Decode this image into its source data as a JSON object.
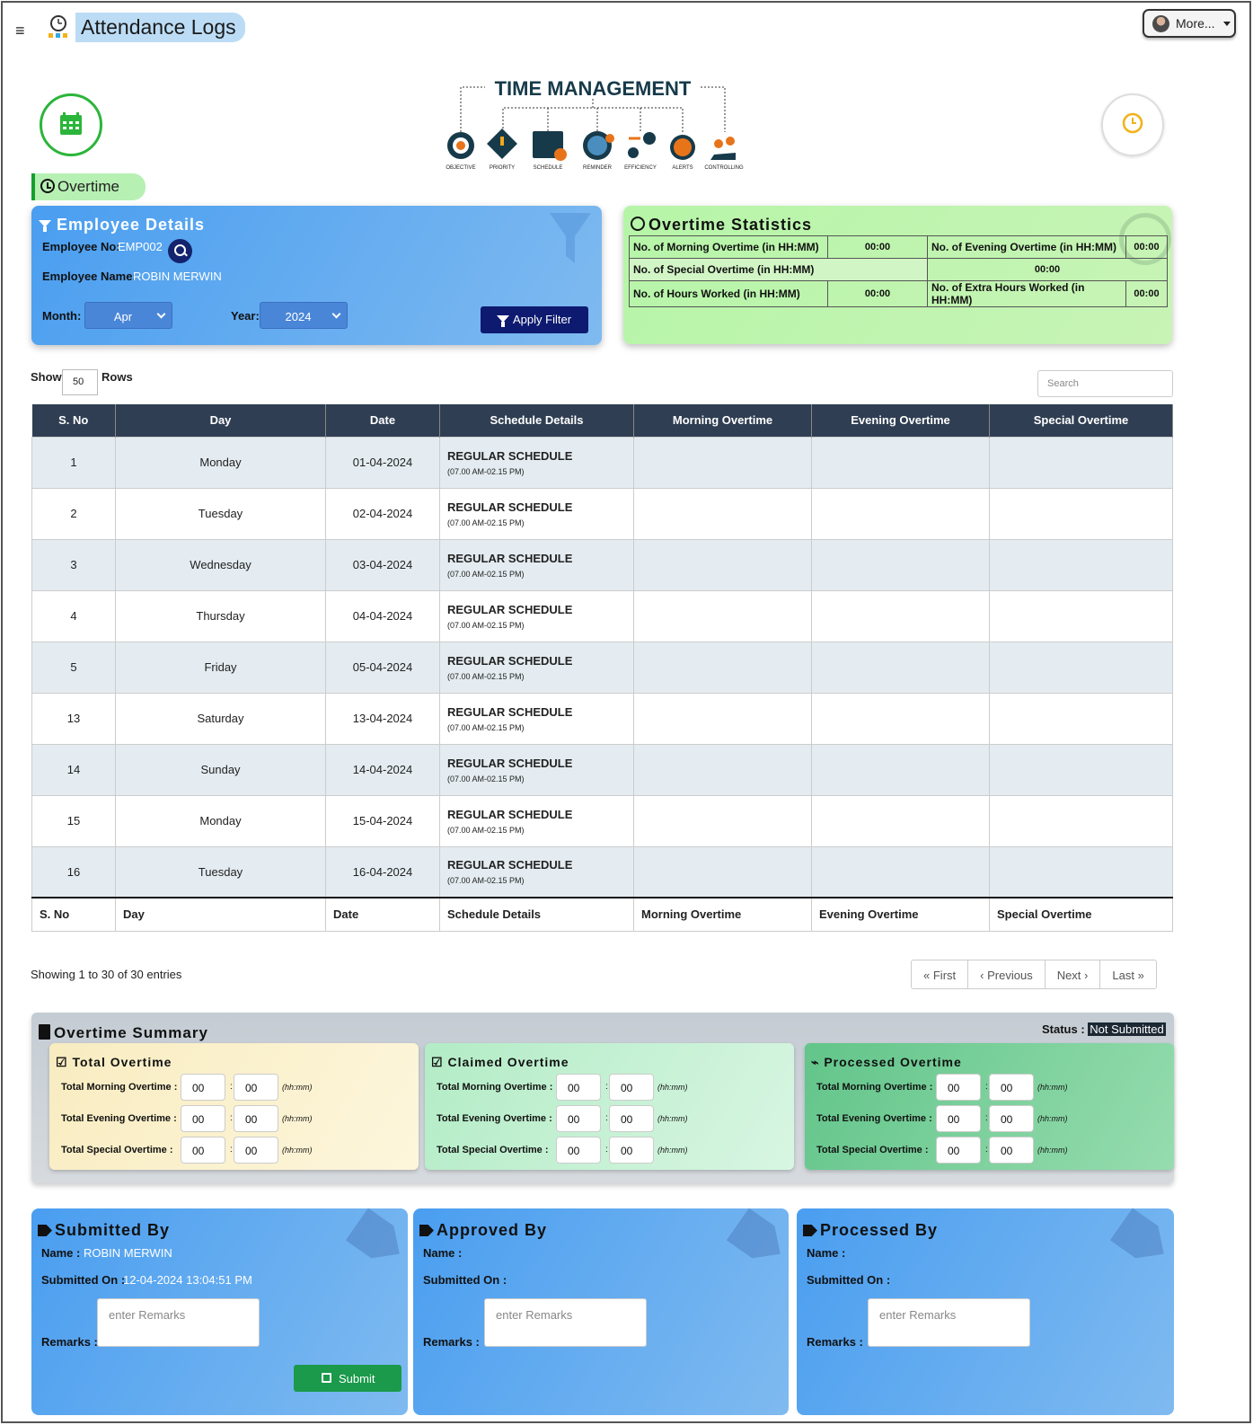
{
  "header": {
    "title": "Attendance Logs",
    "more_label": "More..."
  },
  "banner": {
    "title": "TIME MANAGEMENT",
    "items": [
      "OBJECTIVE",
      "PRIORITY",
      "SCHEDULE",
      "REMINDER",
      "EFFICIENCY",
      "ALERTS",
      "CONTROLLING"
    ]
  },
  "section_label": "Overtime",
  "employee": {
    "title": "Employee Details",
    "no_label": "Employee No:",
    "no_value": "EMP002",
    "name_label": "Employee Name:",
    "name_value": "ROBIN MERWIN",
    "month_label": "Month:",
    "month_value": "Apr",
    "year_label": "Year:",
    "year_value": "2024",
    "apply_label": "Apply Filter"
  },
  "stats": {
    "title": "Overtime Statistics",
    "morning_label": "No. of Morning Overtime (in HH:MM)",
    "morning_value": "00:00",
    "evening_label": "No. of Evening Overtime (in HH:MM)",
    "evening_value": "00:00",
    "special_label": "No. of Special Overtime (in HH:MM)",
    "special_value": "00:00",
    "worked_label": "No. of Hours Worked (in HH:MM)",
    "worked_value": "00:00",
    "extra_label": "No. of Extra Hours Worked (in HH:MM)",
    "extra_value": "00:00"
  },
  "table_controls": {
    "show_label": "Show",
    "rows_value": "50",
    "rows_label": "Rows",
    "search_placeholder": "Search"
  },
  "table": {
    "columns": [
      "S. No",
      "Day",
      "Date",
      "Schedule Details",
      "Morning Overtime",
      "Evening Overtime",
      "Special Overtime"
    ],
    "rows": [
      {
        "sno": "1",
        "day": "Monday",
        "date": "01-04-2024",
        "schedule": "REGULAR SCHEDULE",
        "time": "(07.00 AM-02.15 PM)"
      },
      {
        "sno": "2",
        "day": "Tuesday",
        "date": "02-04-2024",
        "schedule": "REGULAR SCHEDULE",
        "time": "(07.00 AM-02.15 PM)"
      },
      {
        "sno": "3",
        "day": "Wednesday",
        "date": "03-04-2024",
        "schedule": "REGULAR SCHEDULE",
        "time": "(07.00 AM-02.15 PM)"
      },
      {
        "sno": "4",
        "day": "Thursday",
        "date": "04-04-2024",
        "schedule": "REGULAR SCHEDULE",
        "time": "(07.00 AM-02.15 PM)"
      },
      {
        "sno": "5",
        "day": "Friday",
        "date": "05-04-2024",
        "schedule": "REGULAR SCHEDULE",
        "time": "(07.00 AM-02.15 PM)"
      },
      {
        "sno": "13",
        "day": "Saturday",
        "date": "13-04-2024",
        "schedule": "REGULAR SCHEDULE",
        "time": "(07.00 AM-02.15 PM)"
      },
      {
        "sno": "14",
        "day": "Sunday",
        "date": "14-04-2024",
        "schedule": "REGULAR SCHEDULE",
        "time": "(07.00 AM-02.15 PM)"
      },
      {
        "sno": "15",
        "day": "Monday",
        "date": "15-04-2024",
        "schedule": "REGULAR SCHEDULE",
        "time": "(07.00 AM-02.15 PM)"
      },
      {
        "sno": "16",
        "day": "Tuesday",
        "date": "16-04-2024",
        "schedule": "REGULAR SCHEDULE",
        "time": "(07.00 AM-02.15 PM)"
      }
    ]
  },
  "pagination": {
    "info": "Showing 1 to 30 of 30 entries",
    "first": "First",
    "previous": "Previous",
    "next": "Next",
    "last": "Last"
  },
  "summary": {
    "title": "Overtime Summary",
    "status_label": "Status :",
    "status_value": "Not Submitted",
    "groups": [
      {
        "title": "Total Overtime",
        "morning": "Total Morning Overtime :",
        "evening": "Total Evening Overtime :",
        "special": "Total Special Overtime :"
      },
      {
        "title": "Claimed Overtime",
        "morning": "Total Morning Overtime :",
        "evening": "Total Evening Overtime :",
        "special": "Total Special Overtime :"
      },
      {
        "title": "Processed Overtime",
        "morning": "Total Morning Overtime :",
        "evening": "Total Evening Overtime :",
        "special": "Total Special Overtime :"
      }
    ],
    "hh": "00",
    "mm": "00",
    "unit": "(hh:mm)"
  },
  "signoff": {
    "submitted": {
      "title": "Submitted By",
      "name_label": "Name :",
      "name_value": "ROBIN MERWIN",
      "on_label": "Submitted On :",
      "on_value": "12-04-2024 13:04:51 PM",
      "remarks_label": "Remarks :",
      "placeholder": "enter Remarks",
      "submit_label": "Submit"
    },
    "approved": {
      "title": "Approved By",
      "name_label": "Name :",
      "on_label": "Submitted On :",
      "remarks_label": "Remarks :",
      "placeholder": "enter Remarks"
    },
    "processed": {
      "title": "Processed By",
      "name_label": "Name :",
      "on_label": "Submitted On :",
      "remarks_label": "Remarks :",
      "placeholder": "enter Remarks"
    }
  },
  "colors": {
    "header_dark": "#2f3e52",
    "accent_green": "#1a9a4a",
    "navy": "#0d1a70",
    "card_blue": "#4a9ef0"
  }
}
